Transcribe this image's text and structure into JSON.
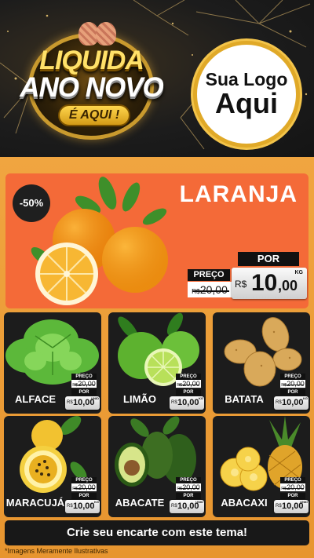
{
  "header": {
    "promo_line1": "LIQUIDA",
    "promo_line2": "ANO NOVO",
    "promo_pill": "É AQUI !",
    "logo_line1": "Sua Logo",
    "logo_line2": "Aqui"
  },
  "hero": {
    "badge": "-50%",
    "title": "LARANJA",
    "por_label": "POR",
    "preco_label": "PREÇO",
    "old_currency": "R$",
    "old_price": "20,00",
    "new_currency": "R$",
    "new_price_int": "10",
    "new_price_dec": ",00",
    "unit": "KG"
  },
  "products": [
    {
      "name": "ALFACE",
      "preco_label": "PREÇO",
      "old_currency": "R$",
      "old_price": "20,00",
      "por_label": "POR",
      "new_currency": "R$",
      "new_price": "10,00",
      "unit": "UNID"
    },
    {
      "name": "LIMÃO",
      "preco_label": "PREÇO",
      "old_currency": "R$",
      "old_price": "20,00",
      "por_label": "POR",
      "new_currency": "R$",
      "new_price": "10,00",
      "unit": "KG"
    },
    {
      "name": "BATATA",
      "preco_label": "PREÇO",
      "old_currency": "R$",
      "old_price": "20,00",
      "por_label": "POR",
      "new_currency": "R$",
      "new_price": "10,00",
      "unit": "KG"
    },
    {
      "name": "MARACUJÁ",
      "preco_label": "PREÇO",
      "old_currency": "R$",
      "old_price": "20,00",
      "por_label": "POR",
      "new_currency": "R$",
      "new_price": "10,00",
      "unit": "KG"
    },
    {
      "name": "ABACATE",
      "preco_label": "PREÇO",
      "old_currency": "R$",
      "old_price": "20,00",
      "por_label": "POR",
      "new_currency": "R$",
      "new_price": "10,00",
      "unit": "UNID"
    },
    {
      "name": "ABACAXI",
      "preco_label": "PREÇO",
      "old_currency": "R$",
      "old_price": "20,00",
      "por_label": "POR",
      "new_currency": "R$",
      "new_price": "10,00",
      "unit": "UNID"
    }
  ],
  "cta": "Crie seu encarte com este tema!",
  "footnote": "*Imagens Meramente Ilustrativas",
  "colors": {
    "orange_bg": "#f0a540",
    "hero_bg": "#f46a38",
    "gold": "#e0a928",
    "dark": "#1c1c1c"
  },
  "icons": [
    "fireworks-decoration",
    "pineapple-crown-icon",
    "orange-fruit-image",
    "lettuce-image",
    "lime-image",
    "potato-image",
    "passion-fruit-image",
    "avocado-image",
    "pineapple-image"
  ]
}
